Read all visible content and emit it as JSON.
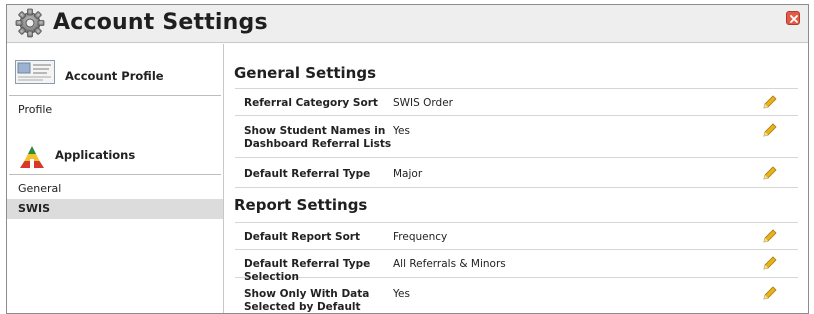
{
  "window": {
    "title": "Account Settings"
  },
  "sidebar": {
    "account_profile_header": "Account Profile",
    "profile_item": "Profile",
    "applications_header": "Applications",
    "items": [
      {
        "label": "General",
        "active": false
      },
      {
        "label": "SWIS",
        "active": true
      }
    ]
  },
  "general_settings": {
    "title": "General Settings",
    "rows": [
      {
        "label": "Referral Category Sort",
        "value": "SWIS Order"
      },
      {
        "label": "Show Student Names in Dashboard Referral Lists",
        "value": "Yes"
      },
      {
        "label": "Default Referral Type",
        "value": "Major"
      }
    ]
  },
  "report_settings": {
    "title": "Report Settings",
    "rows": [
      {
        "label": "Default Report Sort",
        "value": "Frequency"
      },
      {
        "label": "Default Referral Type Selection",
        "value": "All Referrals & Minors"
      },
      {
        "label": "Show Only With Data Selected by Default",
        "value": "Yes"
      }
    ]
  },
  "colors": {
    "accent_pencil": "#e8b31a",
    "close_red": "#e05a47",
    "active_bg": "#dcdcdc"
  },
  "icons": [
    "gear-icon",
    "close-icon",
    "profile-card-icon",
    "applications-triangle-icon",
    "pencil-edit-icon"
  ]
}
